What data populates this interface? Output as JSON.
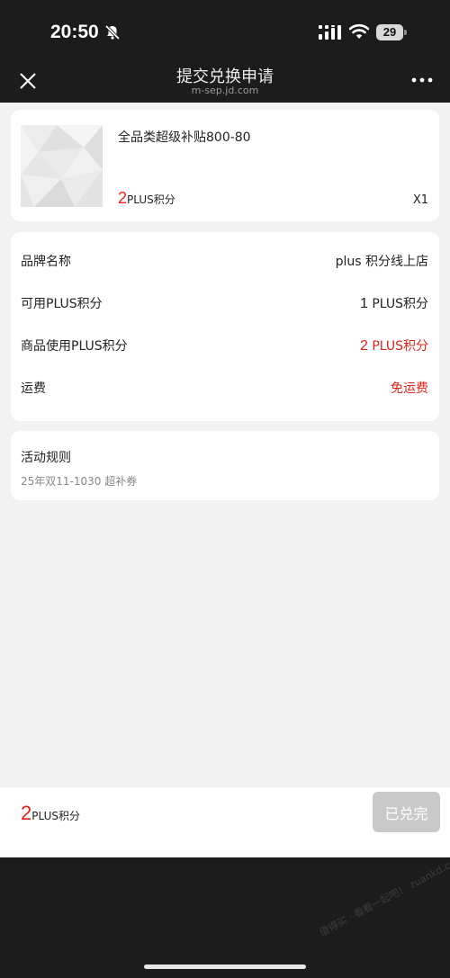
{
  "status_bar": {
    "time": "20:50",
    "battery": "29"
  },
  "nav": {
    "title": "提交兑换申请",
    "subtitle": "m-sep.jd.com"
  },
  "product": {
    "name": "全品类超级补贴800-80",
    "price_value": "2",
    "price_unit": "PLUS积分",
    "quantity": "X1"
  },
  "info": {
    "rows": [
      {
        "label": "品牌名称",
        "value": "plus 积分线上店"
      },
      {
        "label": "可用PLUS积分",
        "value_num": "1",
        "value_unit": "PLUS积分"
      },
      {
        "label": "商品使用PLUS积分",
        "value_num": "2",
        "value_unit": "PLUS积分"
      },
      {
        "label": "运费",
        "value": "免运费"
      }
    ]
  },
  "rules": {
    "title": "活动规则",
    "description": "25年双11-1030 超补券"
  },
  "bottom": {
    "total_value": "2",
    "total_unit": "PLUS积分",
    "button_label": "已兑完"
  },
  "watermark": "值得买 · 看看一起吧！ zuankd.com",
  "colors": {
    "accent_red": "#e2231a",
    "dark_bar": "#1c1c1c",
    "disabled_button": "#c9c9c9",
    "page_bg": "#f2f2f2"
  }
}
